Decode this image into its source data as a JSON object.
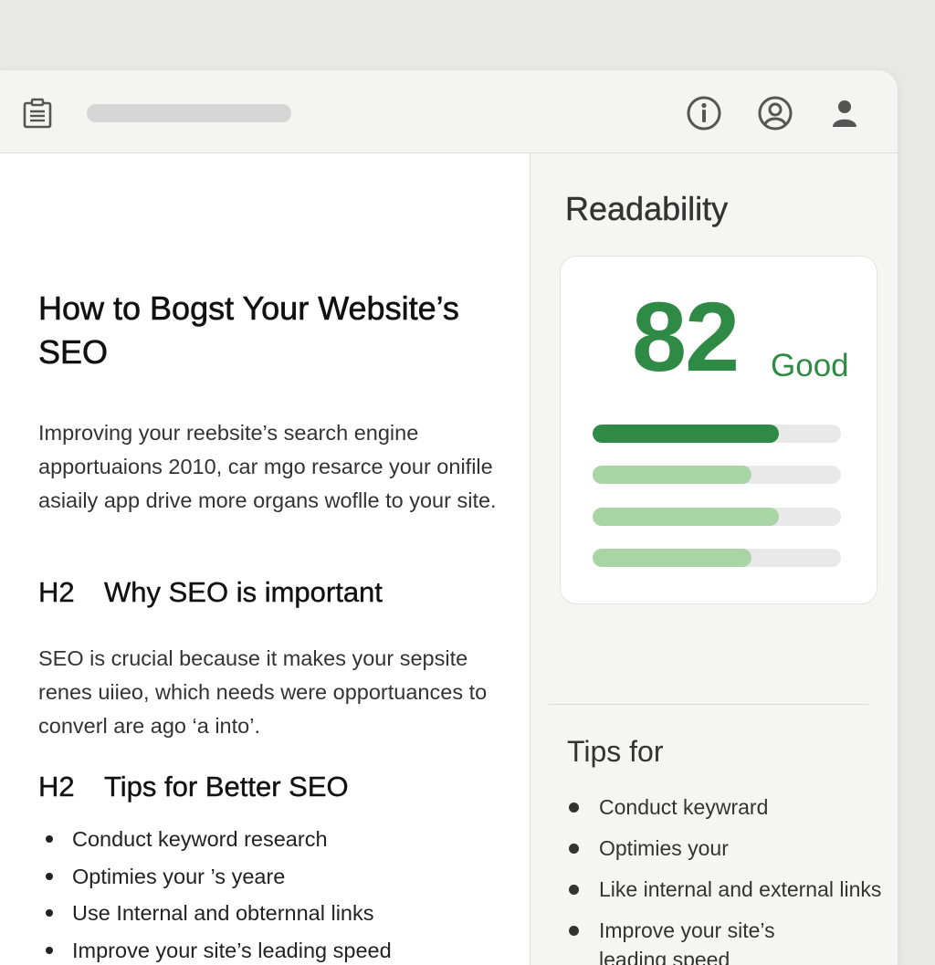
{
  "editor": {
    "title": "How to Bogst Your Website’s SEO",
    "intro": "Improving your reebsite’s search engine apportuaions 2010, car mgo resarce your onifile asiaily app drive more organs woflle to your site.",
    "section1": {
      "tag": "H2",
      "heading": "Why SEO is important",
      "body": "SEO is crucial because it makes your sepsite renes uiieo, which needs were opportuances to converl are ago ‘a into’."
    },
    "section2": {
      "tag": "H2",
      "heading": "Tips for Better SEO",
      "items": [
        "Conduct keyword research",
        "Optimies your ’s yeare",
        "Use Internal and obternnal links",
        "Improve your site’s leading speed"
      ]
    }
  },
  "sidebar": {
    "title": "Readability",
    "score": "82",
    "score_label": "Good",
    "bars": [
      {
        "value": 0.75,
        "color": "#2f8a45"
      },
      {
        "value": 0.64,
        "color": "#a8d4a6"
      },
      {
        "value": 0.75,
        "color": "#a8d4a6"
      },
      {
        "value": 0.64,
        "color": "#a8d4a6"
      }
    ],
    "tips_title": "Tips for",
    "tips": [
      "Conduct keywrard",
      "Optimies your",
      "Like internal and external links",
      "Improve your site’s leading speed"
    ]
  },
  "colors": {
    "accent": "#2f8a45",
    "accent_light": "#a8d4a6"
  }
}
